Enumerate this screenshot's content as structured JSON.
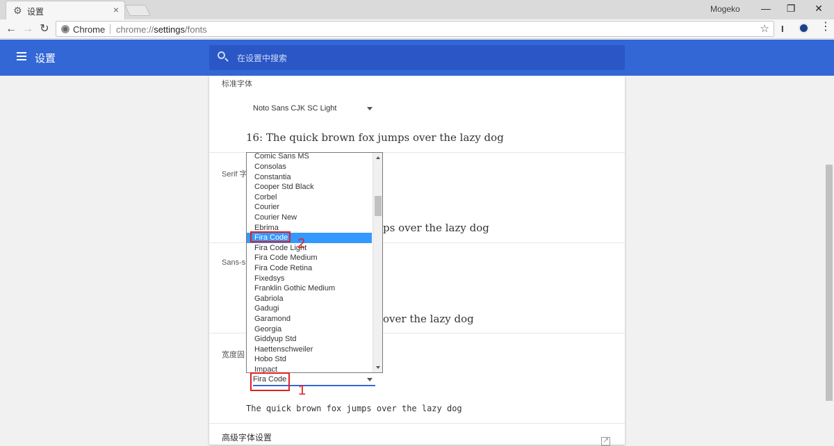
{
  "tab": {
    "title": "设置"
  },
  "window": {
    "profile": "Mogeko",
    "minimize": "—",
    "restore": "❐",
    "close": "✕"
  },
  "toolbar": {
    "back": "←",
    "forward": "→",
    "reload": "↻",
    "site_name": "Chrome",
    "url_scheme": "chrome://",
    "url_host": "settings",
    "url_path": "/fonts",
    "star": "☆",
    "ext1": "I"
  },
  "appbar": {
    "title": "设置",
    "search_placeholder": "在设置中搜索"
  },
  "settings": {
    "standard": {
      "label": "标准字体",
      "font": "Noto Sans CJK SC Light",
      "sample": "16: The quick brown fox jumps over the lazy dog"
    },
    "serif": {
      "label": "Serif 字",
      "sample_tail": "ps over the lazy dog"
    },
    "sans": {
      "label": "Sans-s",
      "sample_tail": "over the lazy dog"
    },
    "fixed": {
      "label": "宽度固",
      "font": "Fira Code",
      "sample": "The quick brown fox jumps over the lazy dog"
    },
    "advanced": {
      "label": "高级字体设置"
    }
  },
  "dropdown": {
    "items": [
      "Comic Sans MS",
      "Consolas",
      "Constantia",
      "Cooper Std Black",
      "Corbel",
      "Courier",
      "Courier New",
      "Ebrima",
      "Fira Code",
      "Fira Code Light",
      "Fira Code Medium",
      "Fira Code Retina",
      "Fixedsys",
      "Franklin Gothic Medium",
      "Gabriola",
      "Gadugi",
      "Garamond",
      "Georgia",
      "Giddyup Std",
      "Haettenschweiler",
      "Hobo Std",
      "Impact"
    ],
    "selected_index": 8
  },
  "annotations": {
    "one": "1",
    "two": "2"
  },
  "colors": {
    "accent": "#3367d6",
    "selection": "#3399ff",
    "annotation": "#e02020"
  }
}
